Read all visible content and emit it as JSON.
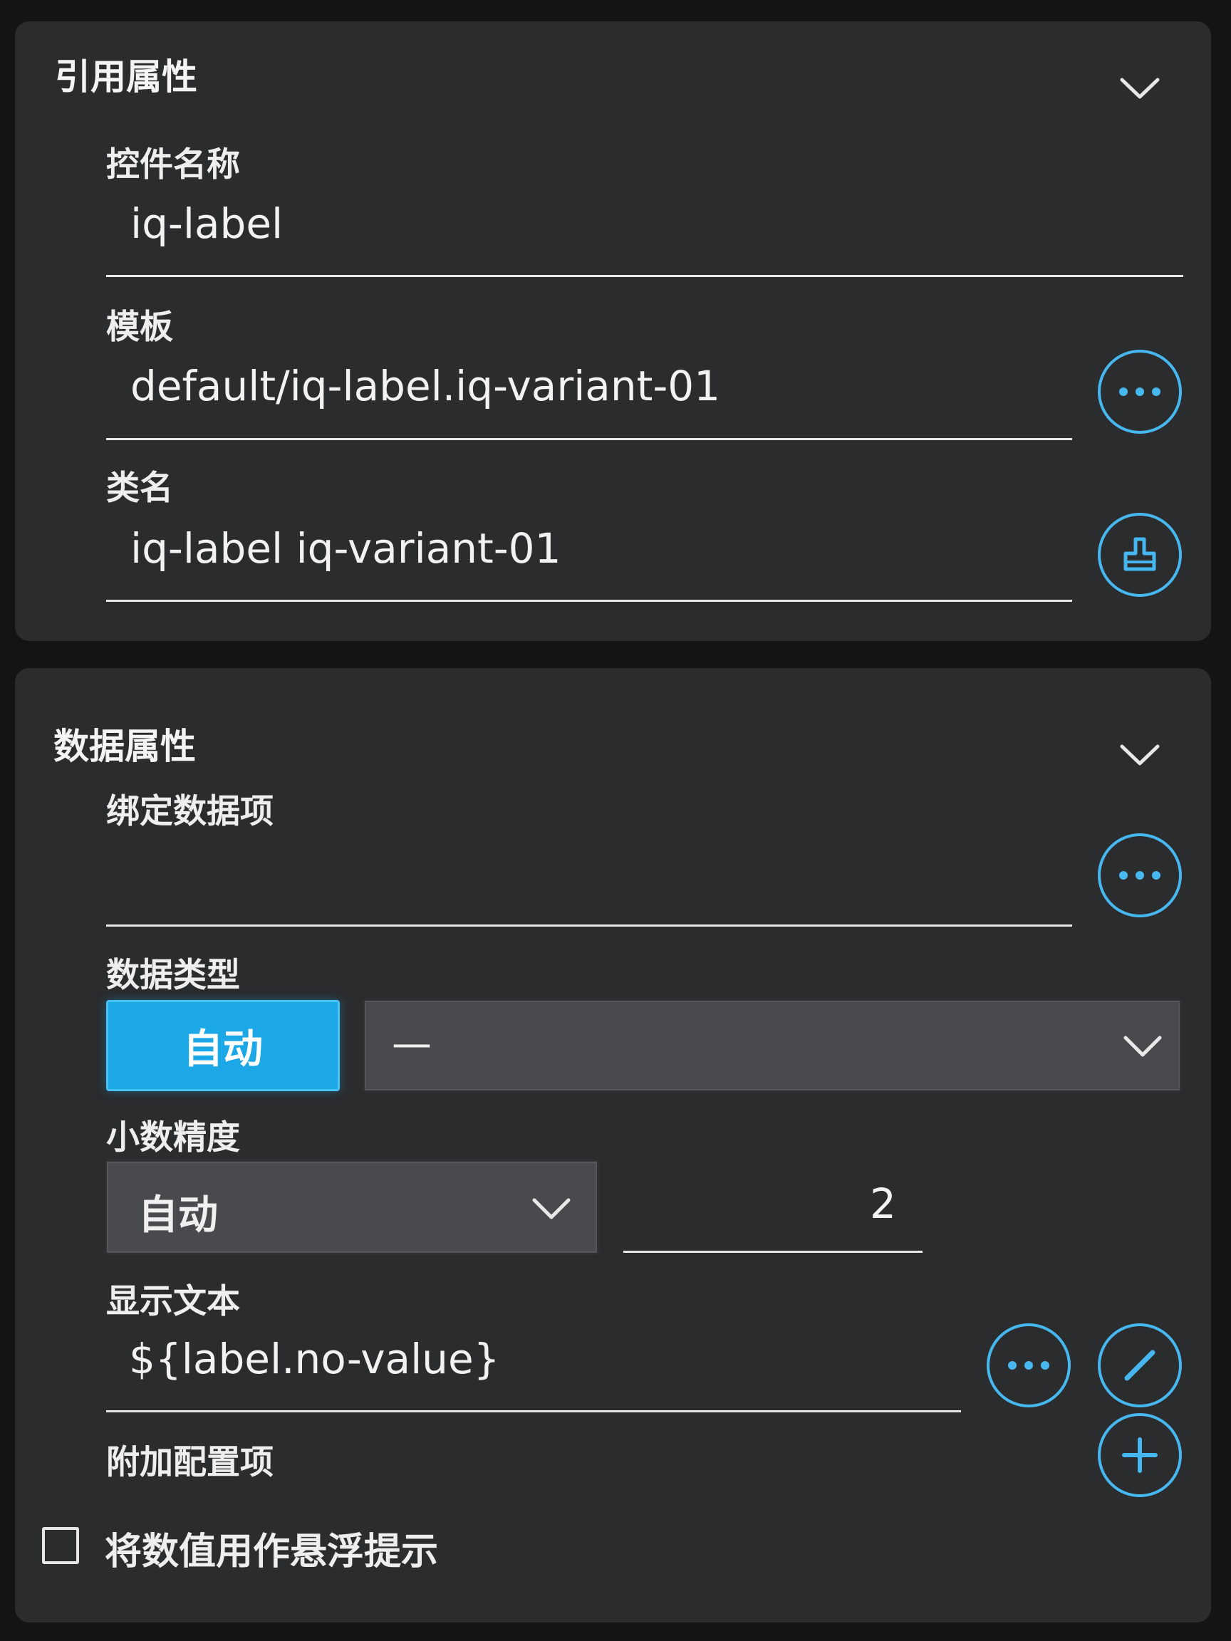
{
  "reference_section": {
    "title": "引用属性",
    "control_name": {
      "label": "控件名称",
      "value": "iq-label"
    },
    "template": {
      "label": "模板",
      "value": "default/iq-label.iq-variant-01",
      "button_icon": "more-horizontal-icon"
    },
    "class_name": {
      "label": "类名",
      "value": "iq-label iq-variant-01",
      "button_icon": "stamp-icon"
    }
  },
  "data_section": {
    "title": "数据属性",
    "bind_item": {
      "label": "绑定数据项",
      "value": "",
      "button_icon": "more-horizontal-icon"
    },
    "data_type": {
      "label": "数据类型",
      "auto_label": "自动",
      "selected": "—"
    },
    "decimal_precision": {
      "label": "小数精度",
      "mode": "自动",
      "value": "2"
    },
    "display_text": {
      "label": "显示文本",
      "value": "${label.no-value}"
    },
    "extra_config": {
      "label": "附加配置项"
    },
    "tooltip_checkbox": {
      "label": "将数值用作悬浮提示",
      "checked": false
    }
  },
  "colors": {
    "accent": "#1ca8e6",
    "icon_ring": "#47b8ef",
    "panel_bg": "#2a2c2e",
    "page_bg": "#131415"
  }
}
